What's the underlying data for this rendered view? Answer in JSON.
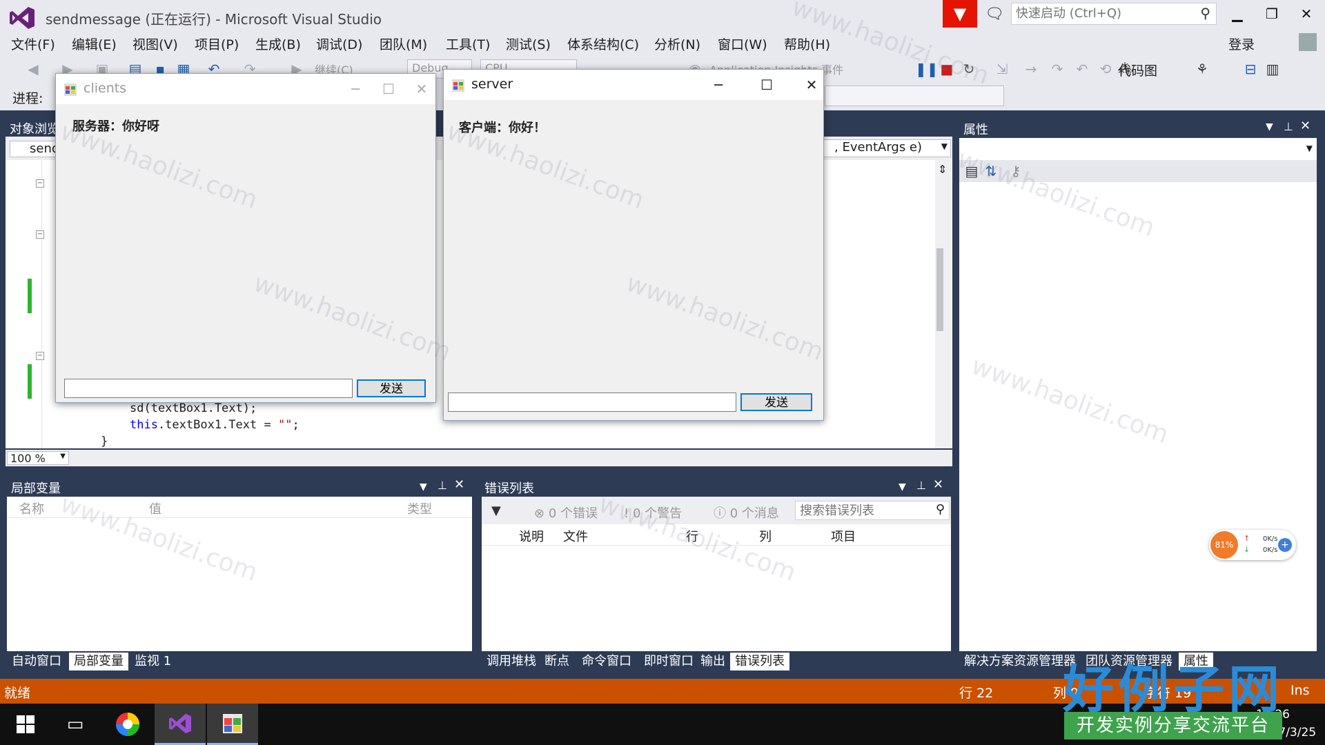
{
  "window": {
    "title": "sendmessage (正在运行) - Microsoft Visual Studio",
    "quicklaunch_placeholder": "快速启动 (Ctrl+Q)",
    "login": "登录"
  },
  "menu": [
    "文件(F)",
    "编辑(E)",
    "视图(V)",
    "项目(P)",
    "生成(B)",
    "调试(D)",
    "团队(M)",
    "工具(T)",
    "测试(S)",
    "体系结构(C)",
    "分析(N)",
    "窗口(W)",
    "帮助(H)"
  ],
  "toolbar": {
    "continue": "继续(C)",
    "config": "Debug",
    "platform": "CPU",
    "insights": "Application Insights 事件",
    "codemap": "代码图",
    "process_label": "进程:"
  },
  "editor": {
    "tab_label": "对象浏览",
    "nav_left": "send",
    "nav_right": ", EventArgs e)",
    "zoom": "100 %",
    "code": [
      {
        "text": "sd(textBox1.Text);"
      },
      {
        "kw": "this",
        "text": ".textBox1.Text = ",
        "str": "\"\"",
        "tail": ";"
      },
      {
        "text": "}"
      }
    ]
  },
  "properties": {
    "title": "属性"
  },
  "locals": {
    "title": "局部变量",
    "columns": [
      "名称",
      "值",
      "类型"
    ]
  },
  "errors": {
    "title": "错误列表",
    "errors_count": "0 个错误",
    "warnings_count": "0 个警告",
    "messages_count": "0 个消息",
    "search_placeholder": "搜索错误列表",
    "columns": [
      "说明",
      "文件",
      "行",
      "列",
      "项目"
    ]
  },
  "bottom_left_tabs": [
    "自动窗口",
    "局部变量",
    "监视 1"
  ],
  "bottom_mid_tabs": [
    "调用堆栈",
    "断点",
    "命令窗口",
    "即时窗口",
    "输出",
    "错误列表"
  ],
  "bottom_right_tabs": [
    "解决方案资源管理器",
    "团队资源管理器",
    "属性"
  ],
  "status": {
    "text": "就绪",
    "line": "行 22",
    "col": "列 9",
    "char": "字符 19",
    "ins": "Ins"
  },
  "net_widget": {
    "cpu": "81%",
    "up": "0K/s",
    "down": "0K/s"
  },
  "clock": {
    "time": "11:26",
    "date": "2017/3/25"
  },
  "clients_form": {
    "title": "clients",
    "message": "服务器：你好呀",
    "input_value": "",
    "send_label": "发送"
  },
  "server_form": {
    "title": "server",
    "message": "客户端：你好！",
    "input_value": "",
    "send_label": "发送"
  },
  "watermark": {
    "text": "www.haolizi.com",
    "brand": "好例子网",
    "tagline": "开发实例分享交流平台"
  }
}
